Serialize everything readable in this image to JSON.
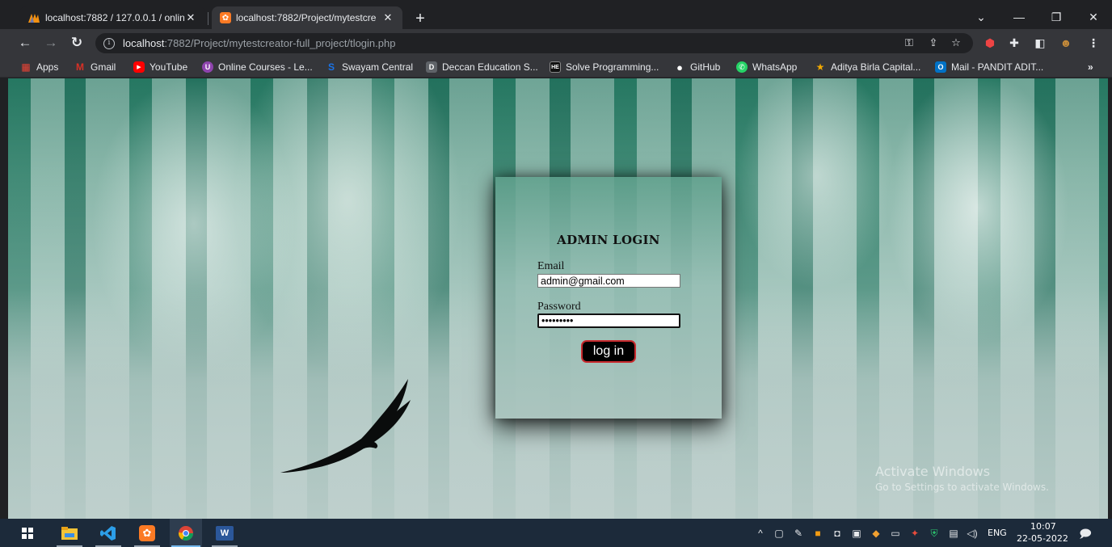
{
  "browser": {
    "tabs": [
      {
        "title": "localhost:7882 / 127.0.0.1 / onlin",
        "close": "✕"
      },
      {
        "title": "localhost:7882/Project/mytestcre",
        "close": "✕"
      }
    ],
    "new_tab": "+",
    "window_controls": {
      "dropdown": "⌄",
      "minimize": "—",
      "restore": "❐",
      "close": "✕"
    },
    "nav": {
      "back": "←",
      "forward": "→",
      "reload": "↻"
    },
    "url_host": "localhost",
    "url_path": ":7882/Project/mytestcreator-full_project/tlogin.php",
    "bookmarks": [
      {
        "label": "Apps",
        "color": "#ea4335",
        "glyph": "▦"
      },
      {
        "label": "Gmail",
        "color": "#d93025",
        "glyph": "M"
      },
      {
        "label": "YouTube",
        "color": "#ff0000",
        "glyph": "▶"
      },
      {
        "label": "Online Courses - Le...",
        "color": "#8e44ad",
        "glyph": "U"
      },
      {
        "label": "Swayam Central",
        "color": "#1a73e8",
        "glyph": "S"
      },
      {
        "label": "Deccan Education S...",
        "color": "#5f6368",
        "glyph": "D"
      },
      {
        "label": "Solve Programming...",
        "color": "#111111",
        "glyph": "HE"
      },
      {
        "label": "GitHub",
        "color": "#ffffff",
        "glyph": "●"
      },
      {
        "label": "WhatsApp",
        "color": "#25d366",
        "glyph": "✆"
      },
      {
        "label": "Aditya Birla Capital...",
        "color": "#f2a900",
        "glyph": "★"
      },
      {
        "label": "Mail - PANDIT ADIT...",
        "color": "#0072c6",
        "glyph": "O"
      }
    ],
    "bookmarks_more": "»"
  },
  "login": {
    "title": "ADMIN LOGIN",
    "email_label": "Email",
    "email_value": "admin@gmail.com",
    "password_label": "Password",
    "password_value": "•••••••••",
    "button_label": "log in"
  },
  "watermark": {
    "line1": "Activate Windows",
    "line2": "Go to Settings to activate Windows."
  },
  "taskbar": {
    "language": "ENG",
    "time": "10:07",
    "date": "22-05-2022"
  }
}
